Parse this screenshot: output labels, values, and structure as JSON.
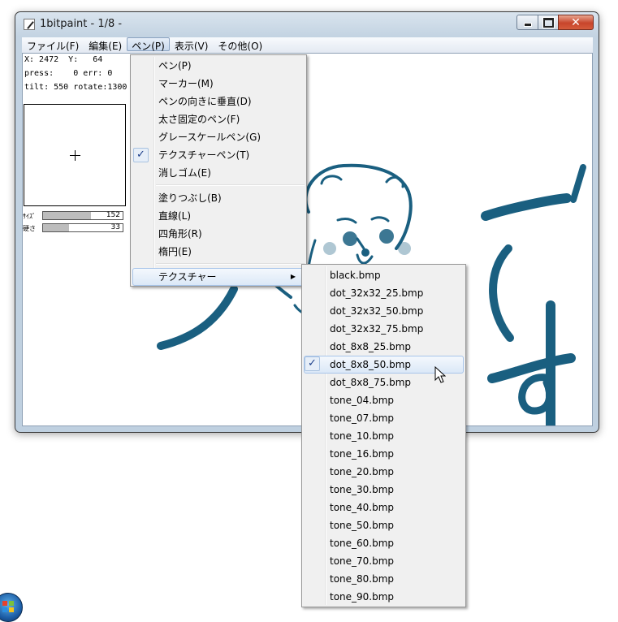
{
  "window": {
    "title": "1bitpaint - 1/8 -",
    "min_glyph": "",
    "close_glyph": "✕"
  },
  "menubar": {
    "file": "ファイル(F)",
    "edit": "編集(E)",
    "pen": "ペン(P)",
    "view": "表示(V)",
    "other": "その他(O)"
  },
  "panel": {
    "coords": "X: 2472  Y:   64",
    "press": "press:    0 err: 0",
    "tilt": "tilt: 550 rotate:1300",
    "size_label": "ｻｲｽﾞ",
    "size_value": "152",
    "size_fraction": 0.6,
    "hardness_label": "硬さ",
    "hardness_value": "33",
    "hardness_fraction": 0.33
  },
  "artwork_text": "です",
  "pen_menu": {
    "items": [
      "ペン(P)",
      "マーカー(M)",
      "ペンの向きに垂直(D)",
      "太さ固定のペン(F)",
      "グレースケールペン(G)",
      "テクスチャーペン(T)",
      "消しゴム(E)"
    ],
    "shapes": [
      "塗りつぶし(B)",
      "直線(L)",
      "四角形(R)",
      "楕円(E)"
    ],
    "texture": "テクスチャー",
    "checked_index": 5,
    "check_mark": "✓",
    "submenu_arrow": "▶"
  },
  "texture_menu": {
    "items": [
      "black.bmp",
      "dot_32x32_25.bmp",
      "dot_32x32_50.bmp",
      "dot_32x32_75.bmp",
      "dot_8x8_25.bmp",
      "dot_8x8_50.bmp",
      "dot_8x8_75.bmp",
      "tone_04.bmp",
      "tone_07.bmp",
      "tone_10.bmp",
      "tone_16.bmp",
      "tone_20.bmp",
      "tone_30.bmp",
      "tone_40.bmp",
      "tone_50.bmp",
      "tone_60.bmp",
      "tone_70.bmp",
      "tone_80.bmp",
      "tone_90.bmp"
    ],
    "selected_index": 5
  },
  "colors": {
    "ink": "#1a5f80",
    "accent": "#1d3f8a"
  }
}
